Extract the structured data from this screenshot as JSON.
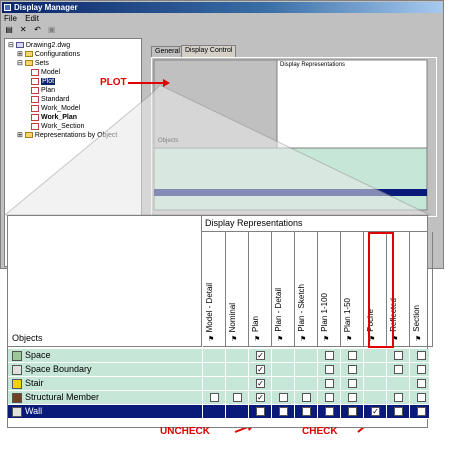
{
  "window": {
    "title": "Display Manager",
    "menu": [
      "File",
      "Edit"
    ],
    "toolbar_icons": [
      "open-icon",
      "delete-icon",
      "undo-icon",
      "properties-icon"
    ]
  },
  "tree": {
    "root": "Drawing2.dwg",
    "items": [
      {
        "label": "Configurations",
        "kind": "folder"
      },
      {
        "label": "Sets",
        "kind": "folder"
      },
      {
        "label": "Model",
        "kind": "set"
      },
      {
        "label": "Plot",
        "kind": "set",
        "selected": true
      },
      {
        "label": "Plan",
        "kind": "set"
      },
      {
        "label": "Standard",
        "kind": "set"
      },
      {
        "label": "Work_Model",
        "kind": "set"
      },
      {
        "label": "Work_Plan",
        "kind": "set",
        "bold": true
      },
      {
        "label": "Work_Section",
        "kind": "set"
      },
      {
        "label": "Representations by Object",
        "kind": "folder"
      }
    ]
  },
  "tabs": [
    "General",
    "Display Control"
  ],
  "annotations": {
    "plot": "PLOT",
    "uncheck": "UNCHECK",
    "check": "CHECK"
  },
  "grid": {
    "group_header": "Display Representations",
    "objects_header": "Objects",
    "columns": [
      "Model - Detail",
      "Nominal",
      "Plan",
      "Plan - Detail",
      "Plan - Sketch",
      "Plan 1-100",
      "Plan 1-50",
      "Poche",
      "Reflected",
      "Section"
    ],
    "rows": [
      {
        "name": "Space",
        "cells": [
          "none",
          "none",
          "checked",
          "none",
          "none",
          "empty",
          "empty",
          "none",
          "empty",
          "empty"
        ]
      },
      {
        "name": "Space Boundary",
        "cells": [
          "none",
          "none",
          "checked",
          "none",
          "none",
          "empty",
          "empty",
          "none",
          "empty",
          "empty"
        ]
      },
      {
        "name": "Stair",
        "cells": [
          "none",
          "none",
          "checked",
          "none",
          "none",
          "empty",
          "empty",
          "none",
          "none",
          "empty"
        ]
      },
      {
        "name": "Structural Member",
        "cells": [
          "empty",
          "empty",
          "checked",
          "empty",
          "empty",
          "empty",
          "empty",
          "none",
          "empty",
          "empty"
        ]
      },
      {
        "name": "Wall",
        "cells": [
          "none",
          "none",
          "empty",
          "empty",
          "empty",
          "empty",
          "empty",
          "checked",
          "empty",
          "empty"
        ],
        "selected": true
      }
    ]
  },
  "colors": {
    "accent": "#e00000",
    "selected_row": "#0a1a78",
    "row_bg": "#c6e6d8",
    "title_bar": "#0a246a"
  }
}
